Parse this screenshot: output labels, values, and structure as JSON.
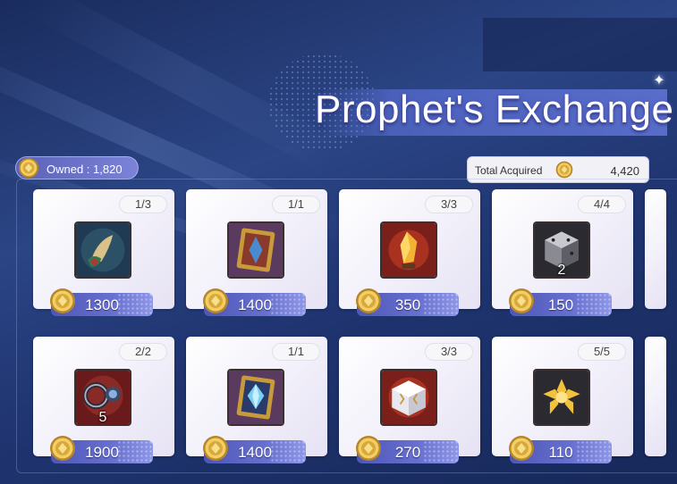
{
  "header": {
    "title": "Prophet's Exchange"
  },
  "owned": {
    "label": "Owned : 1,820",
    "icon": "gold-coin-icon"
  },
  "total_acquired": {
    "label": "Total Acquired",
    "value": "4,420",
    "icon": "gold-coin-icon"
  },
  "items": [
    {
      "counter": "1/3",
      "price": "1300",
      "quantity": "",
      "icon": "pouch-feather-icon"
    },
    {
      "counter": "1/1",
      "price": "1400",
      "quantity": "",
      "icon": "ornate-card-icon"
    },
    {
      "counter": "3/3",
      "price": "350",
      "quantity": "",
      "icon": "crystal-shard-icon"
    },
    {
      "counter": "4/4",
      "price": "150",
      "quantity": "2",
      "icon": "silver-cube-icon"
    },
    {
      "counter": "2/2",
      "price": "1900",
      "quantity": "5",
      "icon": "ring-pendant-icon"
    },
    {
      "counter": "1/1",
      "price": "1400",
      "quantity": "",
      "icon": "blue-gem-card-icon"
    },
    {
      "counter": "3/3",
      "price": "270",
      "quantity": "",
      "icon": "white-chest-icon"
    },
    {
      "counter": "5/5",
      "price": "110",
      "quantity": "",
      "icon": "gold-flower-icon"
    }
  ],
  "colors": {
    "accent": "#6770cf",
    "background": "#2b4585",
    "card": "#f3f1fa"
  }
}
